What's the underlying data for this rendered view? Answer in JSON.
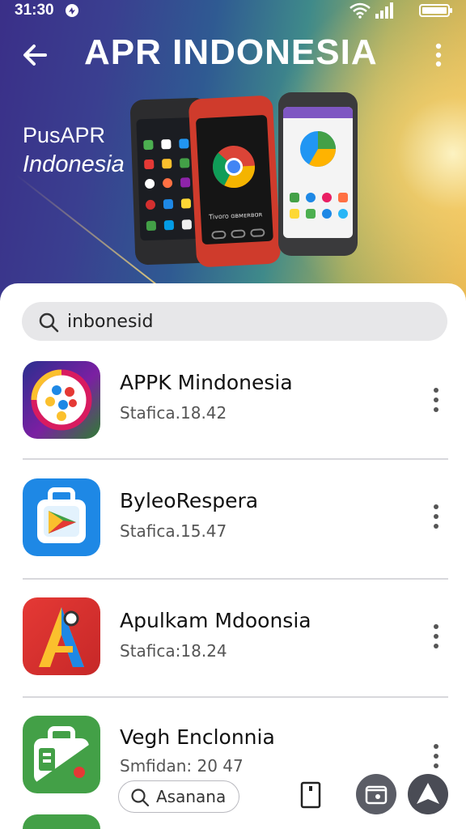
{
  "status_bar": {
    "time": "31:30"
  },
  "header": {
    "title": "APR INDONESIA"
  },
  "banner": {
    "brand_line1": "PusAPR",
    "brand_line2": "Indonesia",
    "promo_text": "Tivoro ɑвᴍᴇʀʙɑʀ"
  },
  "search": {
    "value": "inbonesid",
    "placeholder": "Search"
  },
  "apps": [
    {
      "name": "APPK Mindonesia",
      "meta": "Stafica.18.42",
      "icon": "colorful-circle-app-icon"
    },
    {
      "name": "ByleoRespera",
      "meta": "Stafica.15.47",
      "icon": "briefcase-play-app-icon"
    },
    {
      "name": "Apulkam Mdoonsia",
      "meta": "Stafica:18.24",
      "icon": "letter-a-app-icon"
    },
    {
      "name": "Vegh Enclonnia",
      "meta": "Smfidan: 20 47",
      "icon": "green-suitcase-app-icon"
    }
  ],
  "bottom_bar": {
    "pill_label": "Asanana"
  },
  "colors": {
    "accent_purple": "#3a2f88",
    "accent_gold": "#e6b24a",
    "search_bg": "#e7e7e9",
    "fab": "#4a4c55"
  }
}
